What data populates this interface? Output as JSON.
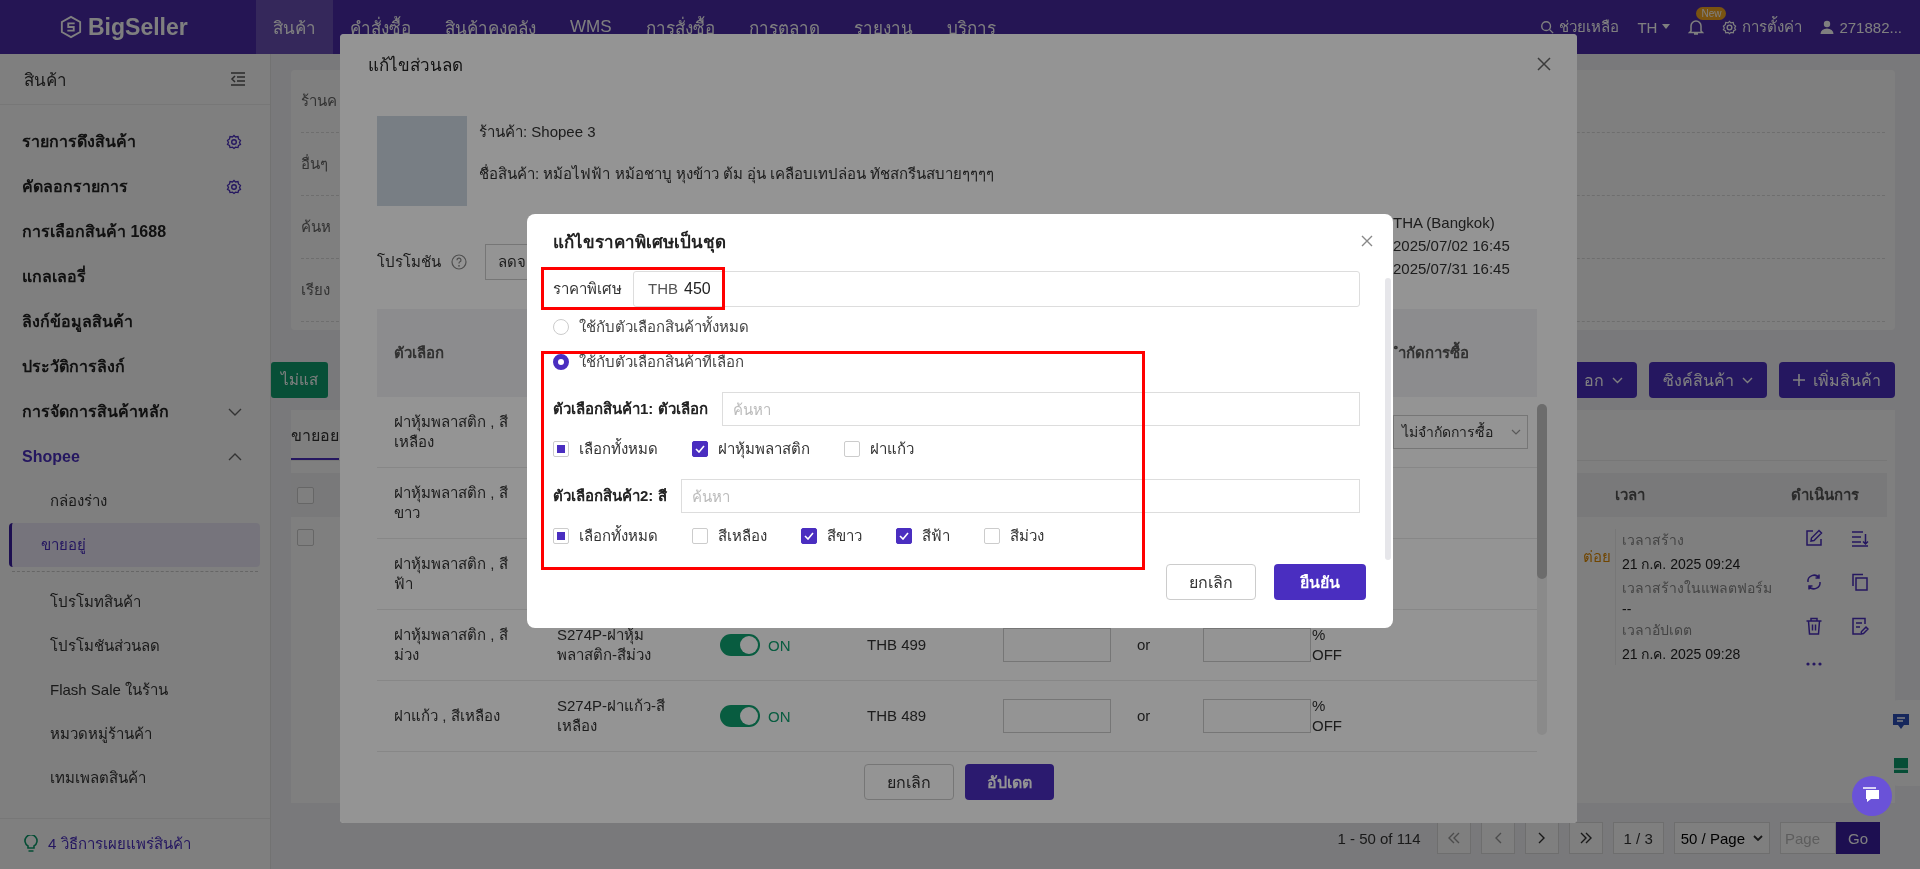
{
  "nav": {
    "logo": "BigSeller",
    "tabs": [
      {
        "label": "สินค้า",
        "selected": true
      },
      {
        "label": "คำสั่งซื้อ",
        "selected": false
      },
      {
        "label": "สินค้าคงคลัง",
        "selected": false
      },
      {
        "label": "WMS",
        "selected": false
      },
      {
        "label": "การสั่งซื้อ",
        "selected": false
      },
      {
        "label": "การตลาด",
        "selected": false
      },
      {
        "label": "รายงาน",
        "selected": false
      },
      {
        "label": "บริการ",
        "selected": false
      }
    ],
    "help": "ช่วยเหลือ",
    "language": "TH",
    "notification_badge": "New",
    "settings": "การตั้งค่า",
    "user": "271882..."
  },
  "sidebar": {
    "title": "สินค้า",
    "items": [
      {
        "label": "รายการดึงสินค้า",
        "kind": "setting",
        "selected": false
      },
      {
        "label": "คัดลอกรายการ",
        "kind": "setting",
        "selected": false
      },
      {
        "label": "การเลือกสินค้า 1688",
        "kind": "plain",
        "selected": false
      },
      {
        "label": "แกลเลอรี่",
        "kind": "plain",
        "selected": false
      },
      {
        "label": "ลิงก์ข้อมูลสินค้า",
        "kind": "plain",
        "selected": false
      },
      {
        "label": "ประวัติการลิงก์",
        "kind": "plain",
        "selected": false
      },
      {
        "label": "การจัดการสินค้าหลัก",
        "kind": "group",
        "expanded": false,
        "selected": false
      },
      {
        "label": "Shopee",
        "kind": "group",
        "expanded": true,
        "selected": false,
        "children": [
          {
            "label": "กล่องร่าง",
            "selected": false
          },
          {
            "label": "ขายอยู่",
            "selected": true
          },
          {
            "label": "โปรโมทสินค้า",
            "selected": false
          },
          {
            "label": "โปรโมชันส่วนลด",
            "selected": false
          },
          {
            "label": "Flash Sale ในร้าน",
            "selected": false
          },
          {
            "label": "หมวดหมู่ร้านค้า",
            "selected": false
          },
          {
            "label": "เทมเพลตสินค้า",
            "selected": false
          }
        ]
      }
    ],
    "tip": "4 วิธีการเผยแพร่สินค้า"
  },
  "page": {
    "filter_labels": [
      "ร้านค",
      "อื่นๆ",
      "ค้นห",
      "เรียง"
    ],
    "toolbar": {
      "left_button": "ไม่แส",
      "right_buttons": [
        {
          "label": "อก",
          "kind": "dropdown"
        },
        {
          "label": "ซิงค์สินค้า",
          "kind": "dropdown"
        },
        {
          "label": "เพิ่มสินค้า",
          "kind": "add"
        }
      ]
    },
    "tabs": [
      {
        "label": "ขายอย",
        "selected": true
      }
    ],
    "table": {
      "header_checked": false,
      "columns": [
        "เวลา",
        "ดำเนินการ"
      ],
      "row": {
        "checked": false,
        "status_note": "ต่อย",
        "times": [
          {
            "label": "เวลาสร้าง",
            "value": "21 ก.ค. 2025 09:24"
          },
          {
            "label": "เวลาสร้างในแพลตฟอร์ม",
            "value": "--"
          },
          {
            "label": "เวลาอัปเดต",
            "value": "21 ก.ค. 2025 09:28"
          }
        ]
      }
    },
    "pagination": {
      "summary": "1 - 50 of 114",
      "page": "1 / 3",
      "page_size": "50 / Page",
      "jump_placeholder": "Page",
      "go": "Go"
    }
  },
  "discount_modal": {
    "title": "แก้ไขส่วนลด",
    "shop": "ร้านค้า: Shopee 3",
    "product": "ชื่อสินค้า: หม้อไฟฟ้า หม้อชาบู หุงข้าว ต้ม อุ่น เคลือบเทปล่อน ทัชสกรีนสบายๆๆๆๆ",
    "promotion_label": "โปรโมชัน",
    "promotion_value": "ลดจ",
    "timezone": "THA (Bangkok)",
    "start": "2025/07/02 16:45",
    "end": "2025/07/31 16:45",
    "columns": [
      "ตัวเลือก",
      "ำกัดการซื้อ"
    ],
    "rows": [
      {
        "variant": "ฝาหุ้มพลาสติก , สีเหลือง",
        "limit": "ไม่จำกัดการซื้อ"
      },
      {
        "variant": "ฝาหุ้มพลาสติก , สีขาว"
      },
      {
        "variant": "ฝาหุ้มพลาสติก , สีฟ้า"
      },
      {
        "variant": "ฝาหุ้มพลาสติก , สีม่วง",
        "sku": "S274P-ฝาหุ้มพลาสติก-สีม่วง",
        "on": true,
        "toggle_label": "ON",
        "price": "THB 499",
        "connector": "or",
        "percent": "% OFF"
      },
      {
        "variant": "ฝาแก้ว , สีเหลือง",
        "sku": "S274P-ฝาแก้ว-สีเหลือง",
        "on": true,
        "toggle_label": "ON",
        "price": "THB 489",
        "connector": "or",
        "percent": "% OFF"
      }
    ],
    "cancel": "ยกเลิก",
    "update": "อัปเดต"
  },
  "dialog": {
    "title": "แก้ไขราคาพิเศษเป็นชุด",
    "price_label": "ราคาพิเศษ",
    "currency": "THB",
    "price": "450",
    "scopes": [
      {
        "label": "ใช้กับตัวเลือกสินค้าทั้งหมด",
        "selected": false
      },
      {
        "label": "ใช้กับตัวเลือกสินค้าที่เลือก",
        "selected": true
      }
    ],
    "variant_groups": [
      {
        "label": "ตัวเลือกสินค้า1: ตัวเลือก",
        "placeholder": "ค้นหา",
        "select_all": {
          "label": "เลือกทั้งหมด",
          "checked": false,
          "indeterminate": true
        },
        "options": [
          {
            "label": "ฝาหุ้มพลาสติก",
            "checked": true
          },
          {
            "label": "ฝาแก้ว",
            "checked": false
          }
        ]
      },
      {
        "label": "ตัวเลือกสินค้า2: สี",
        "placeholder": "ค้นหา",
        "select_all": {
          "label": "เลือกทั้งหมด",
          "checked": false,
          "indeterminate": true
        },
        "options": [
          {
            "label": "สีเหลือง",
            "checked": false
          },
          {
            "label": "สีขาว",
            "checked": true
          },
          {
            "label": "สีฟ้า",
            "checked": true
          },
          {
            "label": "สีม่วง",
            "checked": false
          }
        ]
      }
    ],
    "cancel": "ยกเลิก",
    "confirm": "ยืนยัน"
  }
}
